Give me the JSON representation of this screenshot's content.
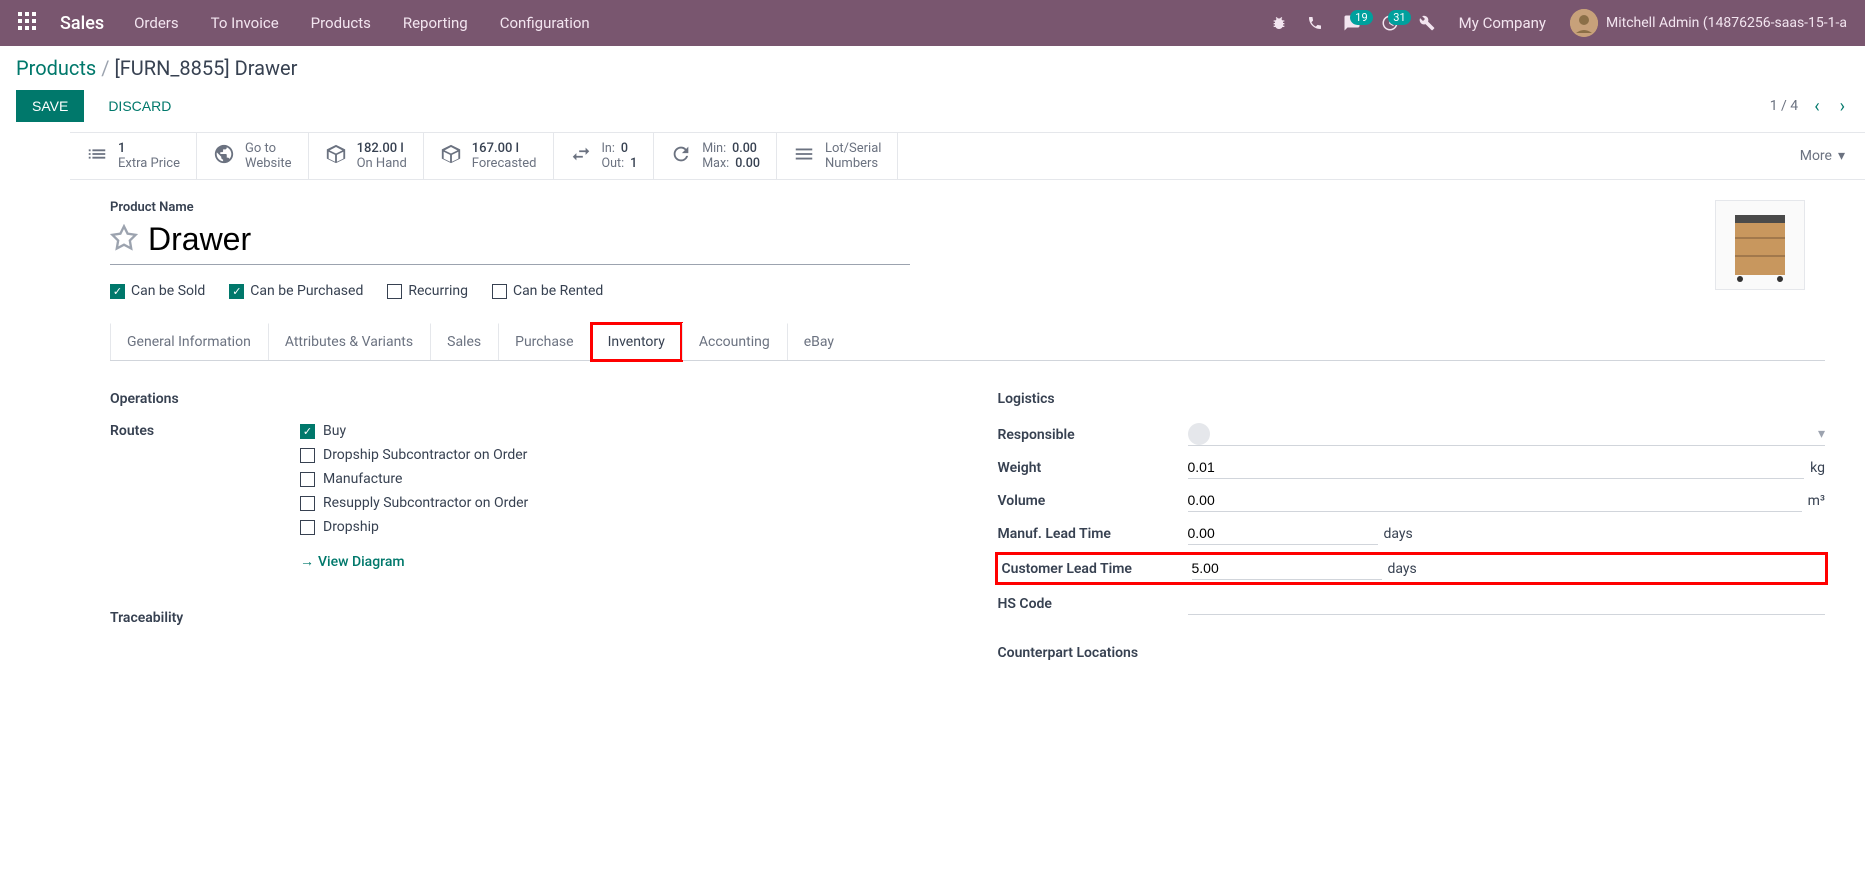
{
  "navbar": {
    "app_name": "Sales",
    "menu": [
      "Orders",
      "To Invoice",
      "Products",
      "Reporting",
      "Configuration"
    ],
    "messages_badge": "19",
    "activities_badge": "31",
    "company": "My Company",
    "user": "Mitchell Admin (14876256-saas-15-1-a"
  },
  "breadcrumb": {
    "root": "Products",
    "current": "[FURN_8855] Drawer"
  },
  "actions": {
    "save": "SAVE",
    "discard": "DISCARD",
    "pager": "1 / 4"
  },
  "stats": {
    "extra_price": {
      "number": "1",
      "label": "Extra Price"
    },
    "website": {
      "label1": "Go to",
      "label2": "Website"
    },
    "on_hand": {
      "number": "182.00 l",
      "label": "On Hand"
    },
    "forecasted": {
      "number": "167.00 l",
      "label": "Forecasted"
    },
    "transfers": {
      "in_label": "In:",
      "in_val": "0",
      "out_label": "Out:",
      "out_val": "1"
    },
    "reorder": {
      "min_label": "Min:",
      "min_val": "0.00",
      "max_label": "Max:",
      "max_val": "0.00"
    },
    "lot": {
      "label1": "Lot/Serial",
      "label2": "Numbers"
    },
    "more": "More"
  },
  "product": {
    "name_label": "Product Name",
    "name": "Drawer",
    "checks": {
      "can_be_sold": "Can be Sold",
      "can_be_purchased": "Can be Purchased",
      "recurring": "Recurring",
      "can_be_rented": "Can be Rented"
    }
  },
  "tabs": [
    "General Information",
    "Attributes & Variants",
    "Sales",
    "Purchase",
    "Inventory",
    "Accounting",
    "eBay"
  ],
  "sections": {
    "operations_title": "Operations",
    "routes_label": "Routes",
    "routes": [
      "Buy",
      "Dropship Subcontractor on Order",
      "Manufacture",
      "Resupply Subcontractor on Order",
      "Dropship"
    ],
    "view_diagram": "View Diagram",
    "traceability_title": "Traceability",
    "logistics_title": "Logistics",
    "responsible_label": "Responsible",
    "weight_label": "Weight",
    "weight": "0.01",
    "weight_unit": "kg",
    "volume_label": "Volume",
    "volume": "0.00",
    "volume_unit": "m³",
    "manuf_lead_label": "Manuf. Lead Time",
    "manuf_lead": "0.00",
    "manuf_lead_unit": "days",
    "cust_lead_label": "Customer Lead Time",
    "cust_lead": "5.00",
    "cust_lead_unit": "days",
    "hs_code_label": "HS Code",
    "counterpart_title": "Counterpart Locations"
  }
}
